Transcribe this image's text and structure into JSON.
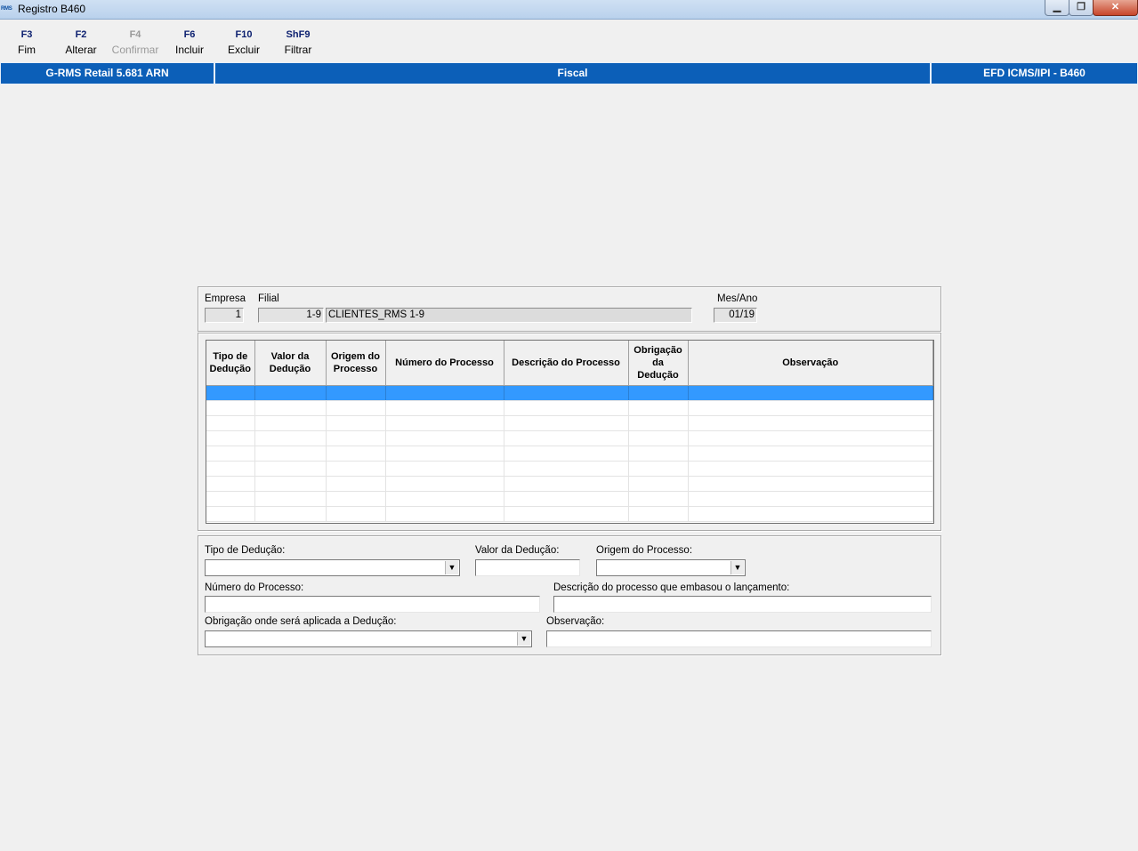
{
  "window": {
    "title": "Registro B460",
    "app_icon_text": "RMS",
    "minimize_glyph": "▁",
    "maximize_glyph": "❐",
    "close_glyph": "✕"
  },
  "toolbar": {
    "items": [
      {
        "key": "F3",
        "label": "Fim",
        "enabled": true
      },
      {
        "key": "F2",
        "label": "Alterar",
        "enabled": true
      },
      {
        "key": "F4",
        "label": "Confirmar",
        "enabled": false
      },
      {
        "key": "F6",
        "label": "Incluir",
        "enabled": true
      },
      {
        "key": "F10",
        "label": "Excluir",
        "enabled": true
      },
      {
        "key": "ShF9",
        "label": "Filtrar",
        "enabled": true
      }
    ]
  },
  "header": {
    "left": "G-RMS Retail 5.681 ARN",
    "center": "Fiscal",
    "right": "EFD ICMS/IPI - B460"
  },
  "top_fields": {
    "empresa_label": "Empresa",
    "empresa_value": "1",
    "filial_label": "Filial",
    "filial_code": "1-9",
    "filial_name": "CLIENTES_RMS 1-9",
    "mesano_label": "Mes/Ano",
    "mesano_value": "01/19"
  },
  "grid": {
    "columns": [
      "Tipo de Dedução",
      "Valor da Dedução",
      "Origem do Processo",
      "Número do Processo",
      "Descrição do Processo",
      "Obrigação da Dedução",
      "Observação"
    ],
    "selected_row": 0,
    "row_count": 9
  },
  "form": {
    "tipo_deducao_label": "Tipo de Dedução:",
    "tipo_deducao_value": "",
    "valor_deducao_label": "Valor da Dedução:",
    "valor_deducao_value": "",
    "origem_processo_label": "Origem do Processo:",
    "origem_processo_value": "",
    "numero_processo_label": "Número do Processo:",
    "numero_processo_value": "",
    "descricao_label": "Descrição do processo que embasou o lançamento:",
    "descricao_value": "",
    "obrigacao_label": "Obrigação onde será aplicada a Dedução:",
    "obrigacao_value": "",
    "observacao_label": "Observação:",
    "observacao_value": "",
    "dropdown_glyph": "▼"
  },
  "colors": {
    "header_blue": "#0c5fb8",
    "selection_blue": "#3399ff",
    "background": "#f0f0f0"
  }
}
